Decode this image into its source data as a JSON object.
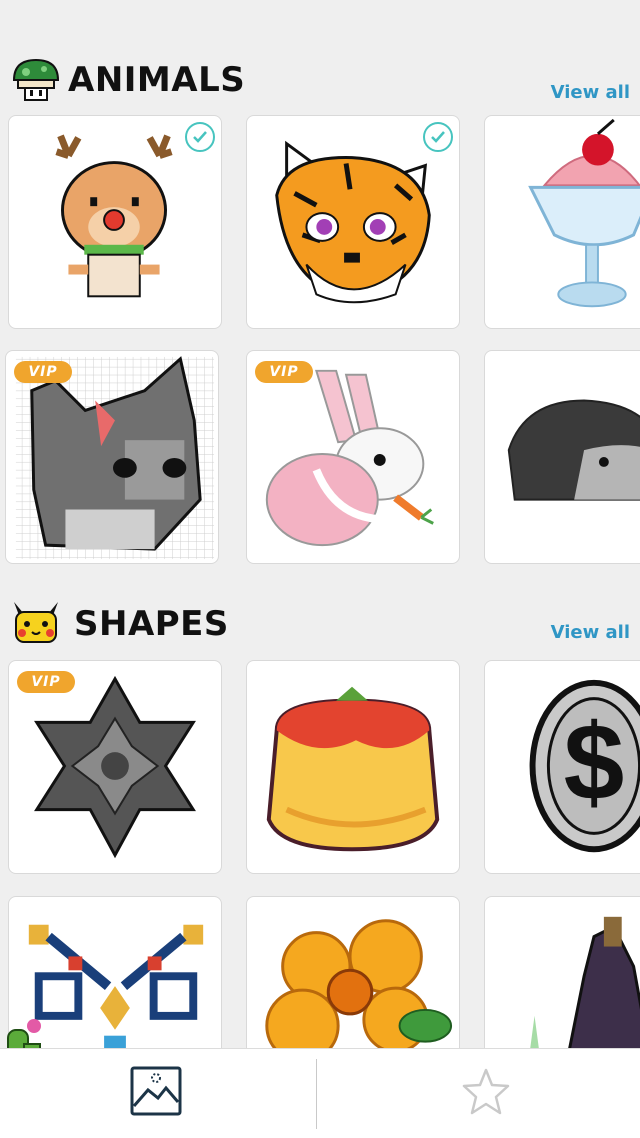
{
  "sections": [
    {
      "title": "ANIMALS",
      "view_all_label": "View all",
      "icon": "mushroom-icon"
    },
    {
      "title": "SHAPES",
      "view_all_label": "View all",
      "icon": "pikachu-icon"
    }
  ],
  "badges": {
    "vip_label": "VIP"
  },
  "cards": [
    {
      "name": "reindeer",
      "status": "completed"
    },
    {
      "name": "tiger",
      "status": "completed"
    },
    {
      "name": "ice-cream-sundae",
      "status": "none"
    },
    {
      "name": "gray-cat",
      "status": "vip"
    },
    {
      "name": "pink-bunny",
      "status": "vip"
    },
    {
      "name": "hedgehog",
      "status": "none"
    },
    {
      "name": "gray-star",
      "status": "vip"
    },
    {
      "name": "pudding",
      "status": "none"
    },
    {
      "name": "dollar-coin",
      "status": "none"
    },
    {
      "name": "tile-pattern",
      "status": "none"
    },
    {
      "name": "orange-flower",
      "status": "none"
    },
    {
      "name": "witch-hat",
      "status": "none"
    }
  ],
  "tabbar": {
    "tabs": [
      {
        "name": "gallery",
        "icon": "image-icon",
        "active": true
      },
      {
        "name": "favorites",
        "icon": "star-icon",
        "active": false
      }
    ]
  },
  "colors": {
    "accent": "#2f96c5",
    "check": "#47c4bf",
    "vip": "#f0a52d",
    "background": "#efefef"
  }
}
